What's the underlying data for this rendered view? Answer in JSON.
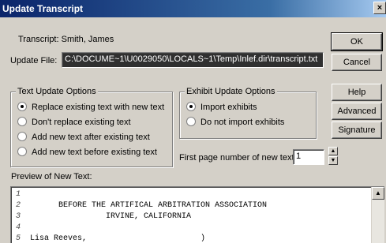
{
  "window": {
    "title": "Update Transcript",
    "close_glyph": "×"
  },
  "transcript": {
    "label": "Transcript: Smith, James"
  },
  "update_file": {
    "label": "Update File:",
    "value": "C:\\DOCUME~1\\U0029050\\LOCALS~1\\Temp\\Inlef.dir\\transcript.txt"
  },
  "buttons": {
    "ok": "OK",
    "cancel": "Cancel",
    "help": "Help",
    "advanced": "Advanced",
    "signature": "Signature"
  },
  "text_options": {
    "legend": "Text Update Options",
    "items": [
      {
        "label": "Replace existing text with new text",
        "selected": true
      },
      {
        "label": "Don't replace existing text",
        "selected": false
      },
      {
        "label": "Add new text after existing text",
        "selected": false
      },
      {
        "label": "Add new text before existing text",
        "selected": false
      }
    ]
  },
  "exhibit_options": {
    "legend": "Exhibit Update Options",
    "items": [
      {
        "label": "Import exhibits",
        "selected": true
      },
      {
        "label": "Do not import exhibits",
        "selected": false
      }
    ]
  },
  "first_page": {
    "label": "First page number of new text:",
    "value": "1"
  },
  "preview": {
    "label": "Preview of New Text:",
    "lines": [
      {
        "num": "1",
        "text": ""
      },
      {
        "num": "2",
        "text": "      BEFORE THE ARTIFICAL ARBITRATION ASSOCIATION"
      },
      {
        "num": "3",
        "text": "                IRVINE, CALIFORNIA"
      },
      {
        "num": "4",
        "text": ""
      },
      {
        "num": "5",
        "text": "Lisa Reeves,                        )"
      }
    ]
  },
  "icons": {
    "close": "close-icon",
    "spin_up": "spin-up-icon",
    "spin_down": "spin-down-icon",
    "scroll_up": "scroll-up-arrow-icon"
  }
}
